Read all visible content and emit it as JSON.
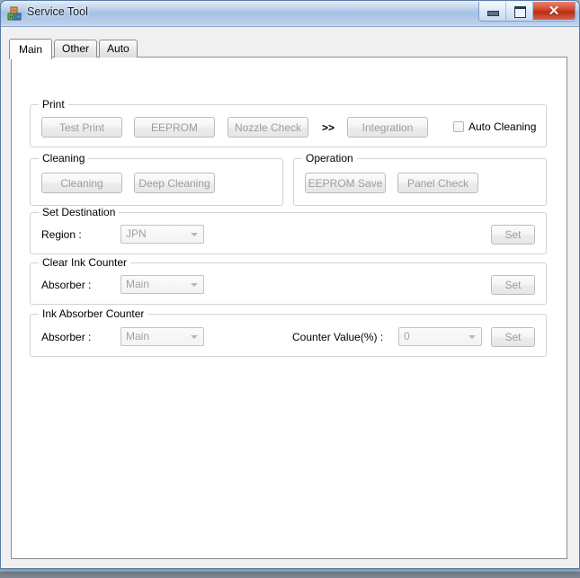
{
  "window": {
    "title": "Service Tool",
    "app_icon": "blocks-icon",
    "controls": {
      "minimize": "minimize-button",
      "maximize": "maximize-button",
      "close_glyph": "✕"
    }
  },
  "tabs": [
    {
      "label": "Main",
      "selected": true
    },
    {
      "label": "Other",
      "selected": false
    },
    {
      "label": "Auto",
      "selected": false
    }
  ],
  "main": {
    "print": {
      "title": "Print",
      "buttons": [
        {
          "label": "Test Print",
          "enabled": false
        },
        {
          "label": "EEPROM",
          "enabled": false
        },
        {
          "label": "Nozzle Check",
          "enabled": false
        },
        {
          "label": "Integration",
          "enabled": false
        }
      ],
      "separator": ">>",
      "auto_cleaning": {
        "label": "Auto Cleaning",
        "checked": false
      }
    },
    "cleaning": {
      "title": "Cleaning",
      "buttons": [
        {
          "label": "Cleaning",
          "enabled": false
        },
        {
          "label": "Deep Cleaning",
          "enabled": false
        }
      ]
    },
    "operation": {
      "title": "Operation",
      "buttons": [
        {
          "label": "EEPROM Save",
          "enabled": false
        },
        {
          "label": "Panel Check",
          "enabled": false
        }
      ]
    },
    "set_destination": {
      "title": "Set Destination",
      "region_label": "Region :",
      "region_value": "JPN",
      "set_label": "Set"
    },
    "clear_ink_counter": {
      "title": "Clear Ink Counter",
      "absorber_label": "Absorber :",
      "absorber_value": "Main",
      "set_label": "Set"
    },
    "ink_absorber_counter": {
      "title": "Ink Absorber Counter",
      "absorber_label": "Absorber :",
      "absorber_value": "Main",
      "counter_label": "Counter Value(%) :",
      "counter_value": "0",
      "set_label": "Set"
    }
  },
  "colors": {
    "titlebar_glass": "#a3bfe2",
    "close_red": "#d3462a",
    "client_bg": "#f0f0f0",
    "page_bg": "#ffffff",
    "disabled_text": "#9d9d9d",
    "group_border": "#d3d3d3"
  }
}
